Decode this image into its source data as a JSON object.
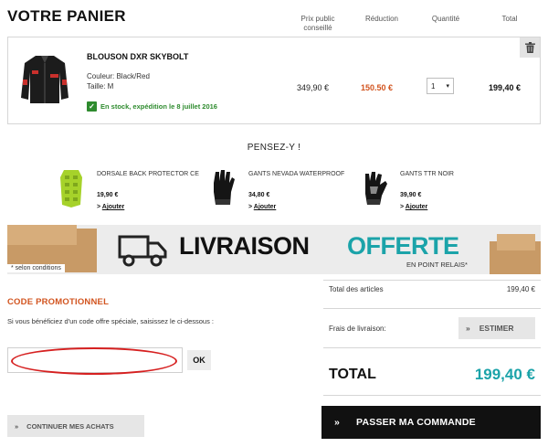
{
  "page_title": "VOTRE PANIER",
  "columns": {
    "price": "Prix public conseillé",
    "reduction": "Réduction",
    "quantity": "Quantité",
    "total": "Total"
  },
  "cart_item": {
    "name": "BLOUSON DXR SKYBOLT",
    "color": "Couleur: Black/Red",
    "size": "Taille: M",
    "stock": "En stock, expédition le 8 juillet 2016",
    "price": "349,90 €",
    "reduction": "150.50 €",
    "quantity": "1",
    "total": "199,40 €"
  },
  "suggestions": {
    "heading": "PENSEZ-Y !",
    "items": [
      {
        "name": "DORSALE BACK PROTECTOR CE",
        "price": "19,90 €",
        "add": "Ajouter"
      },
      {
        "name": "GANTS NEVADA WATERPROOF",
        "price": "34,80 €",
        "add": "Ajouter"
      },
      {
        "name": "GANTS TTR NOIR",
        "price": "39,90 €",
        "add": "Ajouter"
      }
    ]
  },
  "banner": {
    "title_dark": "LIVRAISON",
    "title_accent": "OFFERTE",
    "subtitle": "EN POINT RELAIS*",
    "note": "* selon conditions"
  },
  "promo": {
    "title": "CODE PROMOTIONNEL",
    "description": "Si vous bénéficiez d'un code offre spéciale, saisissez le ci-dessous :",
    "value": "",
    "ok_label": "OK"
  },
  "summary": {
    "subtotal_label": "Total des articles",
    "subtotal_value": "199,40 €",
    "shipping_label": "Frais de livraison:",
    "estimate_label": "ESTIMER",
    "total_label": "TOTAL",
    "total_value": "199,40 €",
    "order_label": "PASSER MA COMMANDE"
  },
  "continue_label": "CONTINUER MES ACHATS",
  "colors": {
    "accent_orange": "#d2541f",
    "accent_teal": "#1ba3a9",
    "stock_green": "#2e8b2e",
    "highlight_red": "#d62020"
  },
  "icons": [
    "trash-icon",
    "check-icon",
    "chevron-down-icon",
    "double-chevron-right-icon",
    "truck-icon"
  ]
}
